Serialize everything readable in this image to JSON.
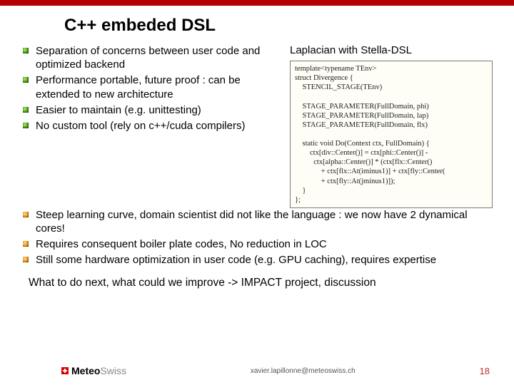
{
  "title": "C++ embeded DSL",
  "pros": [
    "Separation of concerns between user code and optimized backend",
    "Performance portable, future proof : can be extended to new architecture",
    "Easier to maintain (e.g. unittesting)",
    "No custom tool (rely on c++/cuda compilers)"
  ],
  "cons": [
    "Steep learning curve, domain scientist did not like the language : we now have 2 dynamical cores!",
    "Requires consequent boiler plate codes, No reduction in LOC",
    "Still some hardware optimization in user code (e.g. GPU caching), requires expertise"
  ],
  "code_label": "Laplacian with Stella-DSL",
  "code": "template<typename TEnv>\nstruct Divergence {\n    STENCIL_STAGE(TEnv)\n\n    STAGE_PARAMETER(FullDomain, phi)\n    STAGE_PARAMETER(FullDomain, lap)\n    STAGE_PARAMETER(FullDomain, flx)\n\n    static void Do(Context ctx, FullDomain) {\n        ctx[div::Center()] = ctx[phi::Center()] -\n          ctx[alpha::Center()] * (ctx[flx::Center()\n              + ctx[flx::At(iminus1)] + ctx[fly::Center(\n              + ctx[fly::At(jminus1)]);\n    }\n};",
  "closing": "What to do next, what could we improve -> IMPACT project, discussion",
  "footer": {
    "logo_meteo": "Meteo",
    "logo_swiss": "Swiss",
    "email": "xavier.lapillonne@meteoswiss.ch",
    "page": "18"
  }
}
